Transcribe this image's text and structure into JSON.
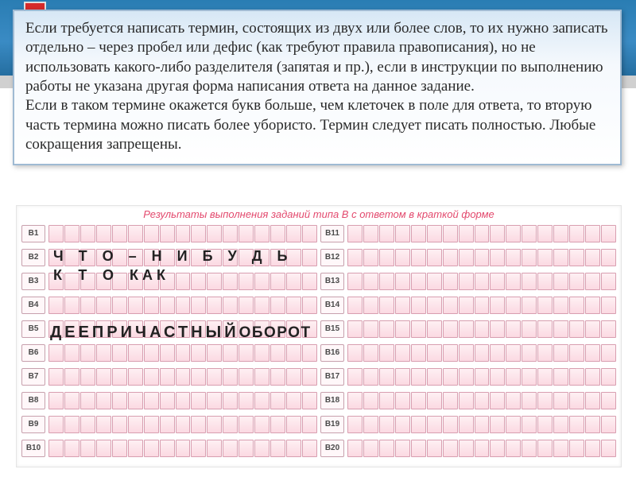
{
  "banner": {},
  "instruction": {
    "para1": "Если требуется написать термин, состоящих из двух или более слов, то их нужно записать отдельно – через пробел или дефис (как требуют правила правописания), но не использовать какого-либо разделителя (запятая и пр.), если в инструкции по выполнению работы не указана другая форма написания ответа на данное задание.",
    "para2": "Если в таком термине окажется букв больше, чем клеточек в поле для ответа, то вторую часть термина можно писать более убористо. Термин следует писать полностью. Любые сокращения запрещены."
  },
  "sheet": {
    "title": "Результаты выполнения заданий типа В с ответом в краткой форме",
    "left_labels": [
      "В1",
      "В2",
      "В3",
      "В4",
      "В5",
      "В6",
      "В7",
      "В8",
      "В9",
      "В10"
    ],
    "right_labels": [
      "В11",
      "В12",
      "В13",
      "В14",
      "В15",
      "В16",
      "В17",
      "В18",
      "В19",
      "В20"
    ],
    "cells_per_row": 17
  },
  "answers": {
    "line1": "Ч Т О – Н И Б У Д Ь",
    "line2a": "КТО",
    "line2b": "КАК",
    "line3a": "ДЕЕПРИЧАСТНЫЙ",
    "line3b": "ОБОРОТ"
  }
}
